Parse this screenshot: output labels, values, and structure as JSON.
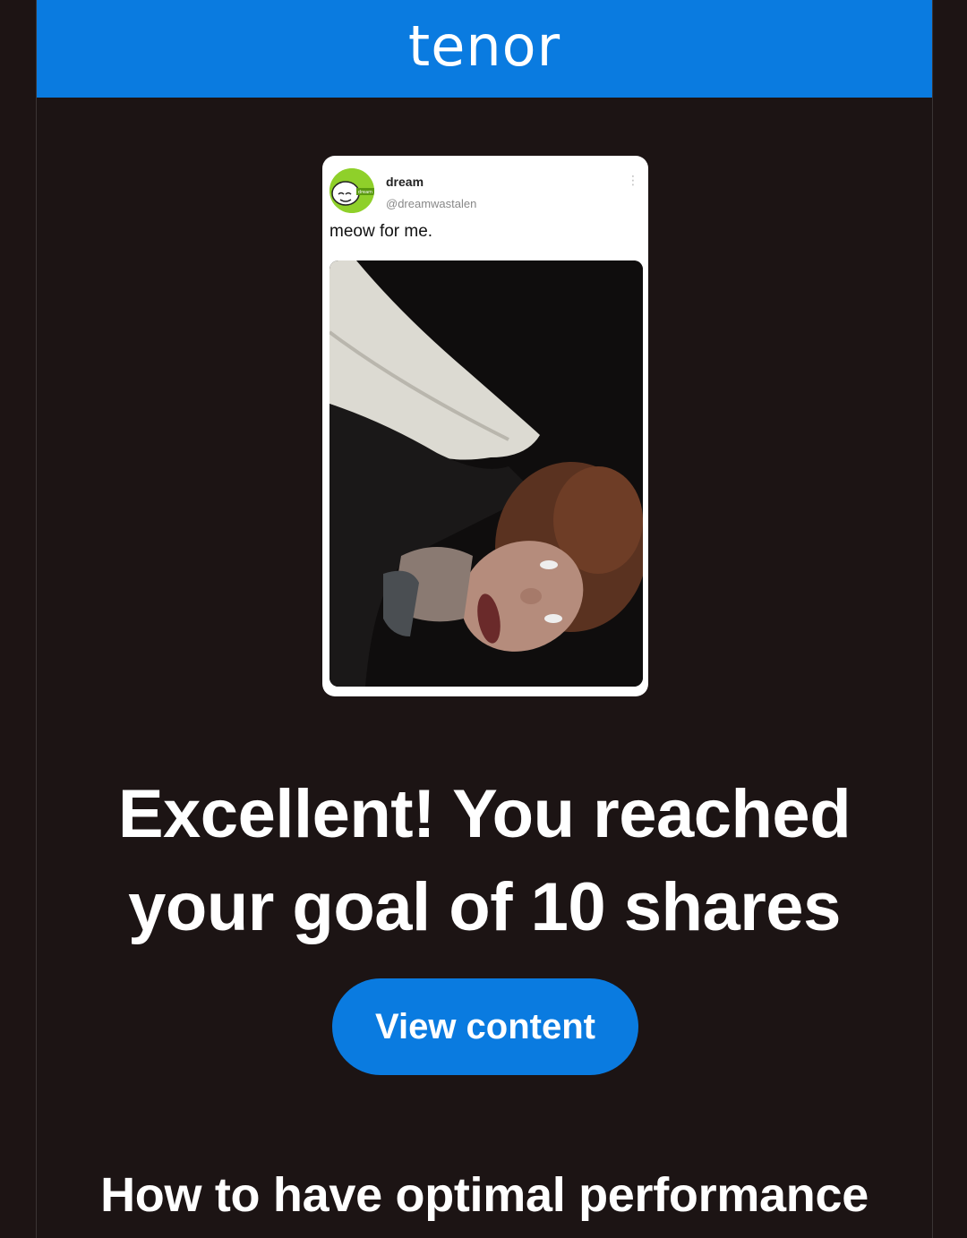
{
  "header": {
    "logo_text": "tenor",
    "brand_color": "#0a7be0"
  },
  "gif_card": {
    "author_name": "dream",
    "author_handle": "@dreamwastalen",
    "avatar_label": "dream",
    "tweet_text": "meow for me.",
    "more_icon": "more-vertical-icon"
  },
  "main": {
    "headline_line1": "Excellent! You reached",
    "headline_line2": "your goal of 10 shares",
    "cta_label": "View content",
    "subheading": "How to have optimal performance"
  },
  "colors": {
    "background": "#1c1414",
    "accent": "#0a7be0",
    "text": "#ffffff"
  }
}
